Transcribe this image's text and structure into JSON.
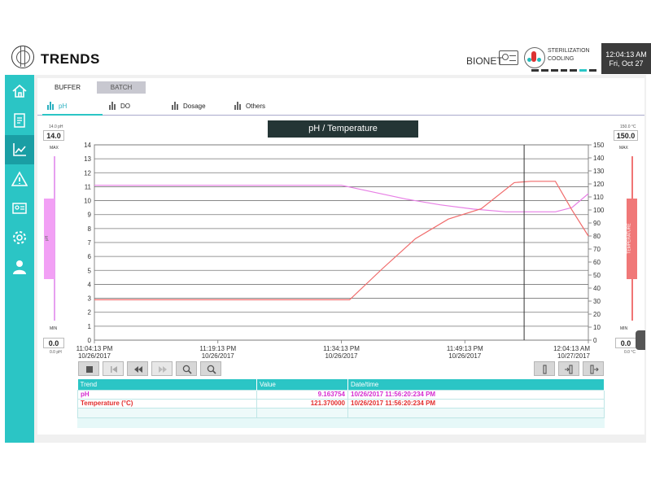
{
  "header": {
    "title": "TRENDS",
    "user_label": "BIONET",
    "status_line1": "STERILIZATION",
    "status_line2": "COOLING",
    "clock_time": "12:04:13 AM",
    "clock_date": "Fri, Oct 27"
  },
  "sidebar": {
    "items": [
      {
        "name": "home-icon"
      },
      {
        "name": "recipe-icon"
      },
      {
        "name": "trends-icon"
      },
      {
        "name": "alarm-icon"
      },
      {
        "name": "id-card-icon"
      },
      {
        "name": "gear-icon"
      },
      {
        "name": "user-icon"
      }
    ]
  },
  "tabs": {
    "buffer": "BUFFER",
    "batch": "BATCH"
  },
  "subtabs": {
    "ph": "pH",
    "do": "DO",
    "dosage": "Dosage",
    "others": "Others"
  },
  "chart_title": "pH / Temperature",
  "left_gauge": {
    "max_small": "14.0 pH",
    "max_value": "14.0",
    "max_label": "MAX",
    "min_label": "MIN",
    "min_value": "0.0",
    "min_small": "0.0 pH",
    "bar_label": "pH"
  },
  "right_gauge": {
    "max_small": "150.0 °C",
    "max_value": "150.0",
    "max_label": "MAX",
    "min_label": "MIN",
    "min_value": "0.0",
    "min_small": "0.0 °C",
    "bar_label": "TEMPERATURE"
  },
  "table": {
    "headers": [
      "Trend",
      "Value",
      "Date/time"
    ],
    "rows": [
      {
        "trend": "pH",
        "value": "9.163754",
        "datetime": "10/26/2017 11:56:20:234 PM"
      },
      {
        "trend": "Temperature (°C)",
        "value": "121.370000",
        "datetime": "10/26/2017 11:56:20:234 PM"
      }
    ]
  },
  "colors": {
    "accent": "#2bc5c5",
    "ph": "#d52cd0",
    "temperature": "#e22e2e"
  },
  "chart_data": {
    "type": "line",
    "title": "pH / Temperature",
    "x_ticks": [
      {
        "t": "11:04:13 PM",
        "d": "10/26/2017"
      },
      {
        "t": "11:19:13 PM",
        "d": "10/26/2017"
      },
      {
        "t": "11:34:13 PM",
        "d": "10/26/2017"
      },
      {
        "t": "11:49:13 PM",
        "d": "10/26/2017"
      },
      {
        "t": "12:04:13 AM",
        "d": "10/27/2017"
      }
    ],
    "x_range_minutes": [
      0,
      60
    ],
    "y_left": {
      "label": "pH",
      "min": 0,
      "max": 14,
      "ticks": [
        0,
        1,
        2,
        3,
        4,
        5,
        6,
        7,
        8,
        9,
        10,
        11,
        12,
        13,
        14
      ]
    },
    "y_right": {
      "label": "Temperature",
      "min": 0,
      "max": 150,
      "ticks": [
        0,
        10,
        20,
        30,
        40,
        50,
        60,
        70,
        80,
        90,
        100,
        110,
        120,
        130,
        140,
        150
      ]
    },
    "cursor_minutes": 52.2,
    "series": [
      {
        "name": "pH",
        "axis": "left",
        "color": "#e77fe5",
        "points": [
          [
            0,
            11.1
          ],
          [
            30,
            11.1
          ],
          [
            34,
            10.6
          ],
          [
            38,
            10.1
          ],
          [
            42,
            9.7
          ],
          [
            46,
            9.4
          ],
          [
            50,
            9.2
          ],
          [
            56,
            9.2
          ],
          [
            58,
            9.5
          ],
          [
            60,
            10.5
          ]
        ]
      },
      {
        "name": "Temperature (°C)",
        "axis": "right",
        "color": "#f06b6b",
        "points": [
          [
            0,
            31
          ],
          [
            31,
            31
          ],
          [
            35,
            55
          ],
          [
            39,
            78
          ],
          [
            43,
            93
          ],
          [
            47,
            101
          ],
          [
            51,
            121
          ],
          [
            53,
            122
          ],
          [
            56,
            122
          ],
          [
            58,
            100
          ],
          [
            60,
            80
          ]
        ]
      }
    ]
  }
}
